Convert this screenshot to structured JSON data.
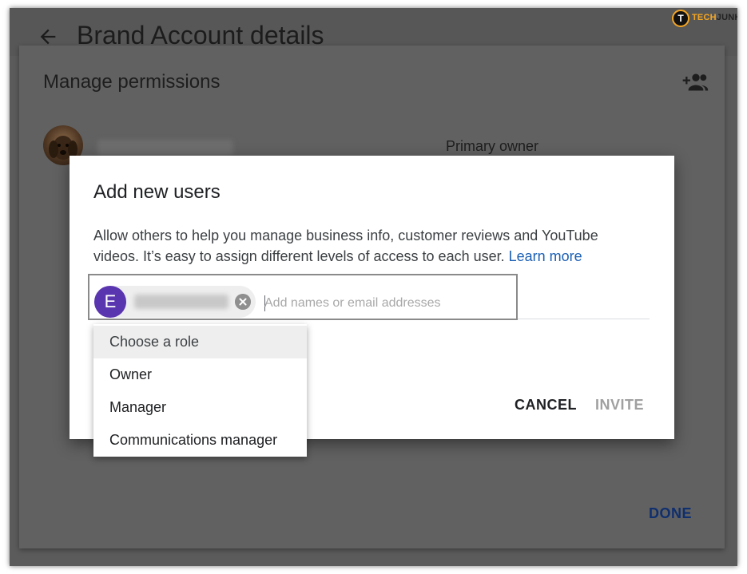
{
  "background": {
    "page_title": "Brand Account details",
    "manage_permissions": {
      "title": "Manage permissions",
      "owner_role": "Primary owner",
      "done_label": "DONE"
    }
  },
  "dialog": {
    "title": "Add new users",
    "description": "Allow others to help you manage business info, customer reviews and YouTube videos. It’s easy to assign different levels of access to each user.",
    "learn_more": "Learn more",
    "chip_initial": "E",
    "input_placeholder": "Add names or email addresses",
    "cancel_label": "CANCEL",
    "invite_label": "INVITE"
  },
  "role_menu": {
    "items": [
      "Choose a role",
      "Owner",
      "Manager",
      "Communications manager"
    ],
    "highlighted_index": 0
  },
  "logo": {
    "mark": "T",
    "text_accent": "TECH",
    "text_rest": "JUNKIE"
  },
  "colors": {
    "link": "#1a5fb4",
    "avatar": "#5a35b0",
    "done": "#0f2f6e",
    "logo_accent": "#f5a623"
  },
  "icons": {
    "back": "arrow-left-icon",
    "add_person": "person-add-icon",
    "chip_remove": "close-circle-icon"
  }
}
